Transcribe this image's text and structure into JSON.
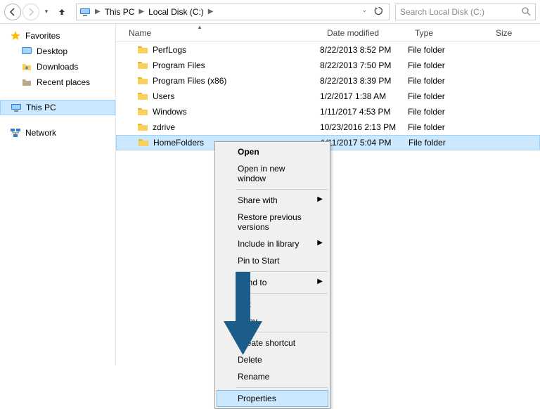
{
  "address": {
    "crumbs": [
      "This PC",
      "Local Disk (C:)"
    ]
  },
  "search": {
    "placeholder": "Search Local Disk (C:)"
  },
  "sidebar": {
    "favorites": {
      "label": "Favorites",
      "items": [
        {
          "label": "Desktop",
          "icon": "desktop"
        },
        {
          "label": "Downloads",
          "icon": "downloads"
        },
        {
          "label": "Recent places",
          "icon": "recent"
        }
      ]
    },
    "thispc": {
      "label": "This PC"
    },
    "network": {
      "label": "Network"
    }
  },
  "columns": {
    "name": "Name",
    "date": "Date modified",
    "type": "Type",
    "size": "Size"
  },
  "rows": [
    {
      "name": "PerfLogs",
      "date": "8/22/2013 8:52 PM",
      "type": "File folder"
    },
    {
      "name": "Program Files",
      "date": "8/22/2013 7:50 PM",
      "type": "File folder"
    },
    {
      "name": "Program Files (x86)",
      "date": "8/22/2013 8:39 PM",
      "type": "File folder"
    },
    {
      "name": "Users",
      "date": "1/2/2017 1:38 AM",
      "type": "File folder"
    },
    {
      "name": "Windows",
      "date": "1/11/2017 4:53 PM",
      "type": "File folder"
    },
    {
      "name": "zdrive",
      "date": "10/23/2016 2:13 PM",
      "type": "File folder"
    },
    {
      "name": "HomeFolders",
      "date": "1/11/2017 5:04 PM",
      "type": "File folder",
      "selected": true
    }
  ],
  "context_menu": [
    {
      "label": "Open",
      "bold": true
    },
    {
      "label": "Open in new window"
    },
    {
      "sep": true
    },
    {
      "label": "Share with",
      "submenu": true
    },
    {
      "label": "Restore previous versions"
    },
    {
      "label": "Include in library",
      "submenu": true
    },
    {
      "label": "Pin to Start"
    },
    {
      "sep": true
    },
    {
      "label": "Send to",
      "submenu": true
    },
    {
      "sep": true
    },
    {
      "label": "Cut"
    },
    {
      "label": "Copy"
    },
    {
      "sep": true
    },
    {
      "label": "Create shortcut"
    },
    {
      "label": "Delete"
    },
    {
      "label": "Rename"
    },
    {
      "sep": true
    },
    {
      "label": "Properties",
      "highlighted": true
    }
  ]
}
